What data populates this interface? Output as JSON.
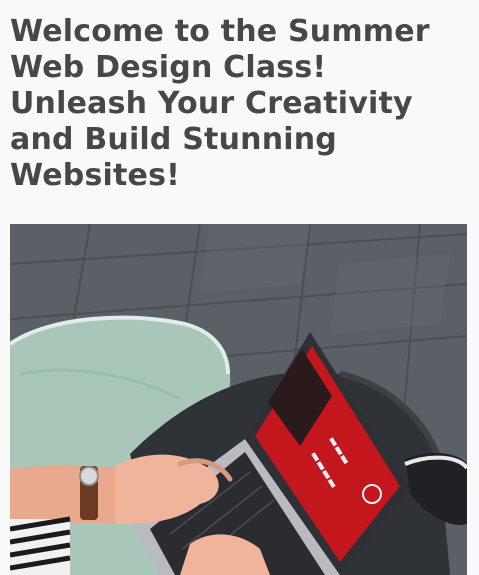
{
  "article": {
    "title": "Welcome to the Summer Web Design Class! Unleash Your Creativity and Build Stunning Websites!"
  },
  "hero_image": {
    "subject": "person typing on a laptop while sitting on a mint green bean bag",
    "colors": {
      "floor": "#5b6066",
      "floor_light": "#6b7077",
      "beanbag": "#a8c7b9",
      "screen": "#c3161d",
      "laptop": "#2e3035",
      "skin": "#e9a98c"
    }
  }
}
